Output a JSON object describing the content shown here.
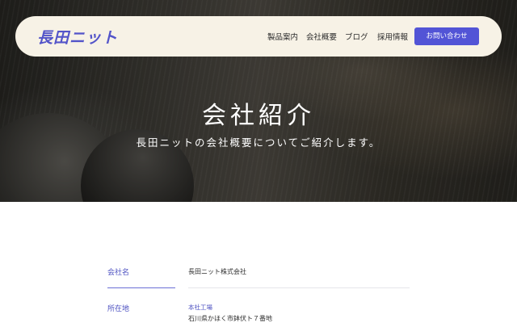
{
  "header": {
    "logo": "長田ニット",
    "nav": [
      "製品案内",
      "会社概要",
      "ブログ",
      "採用情報"
    ],
    "cta": "お問い合わせ"
  },
  "hero": {
    "title": "会社紹介",
    "subtitle": "長田ニットの会社概要についてご紹介します。"
  },
  "company_info": {
    "rows": [
      {
        "label": "会社名",
        "value": "長田ニット株式会社"
      },
      {
        "label": "所在地",
        "sub_label": "本社工場",
        "value": "石川県かほく市鉢伏ト７番地"
      }
    ]
  }
}
